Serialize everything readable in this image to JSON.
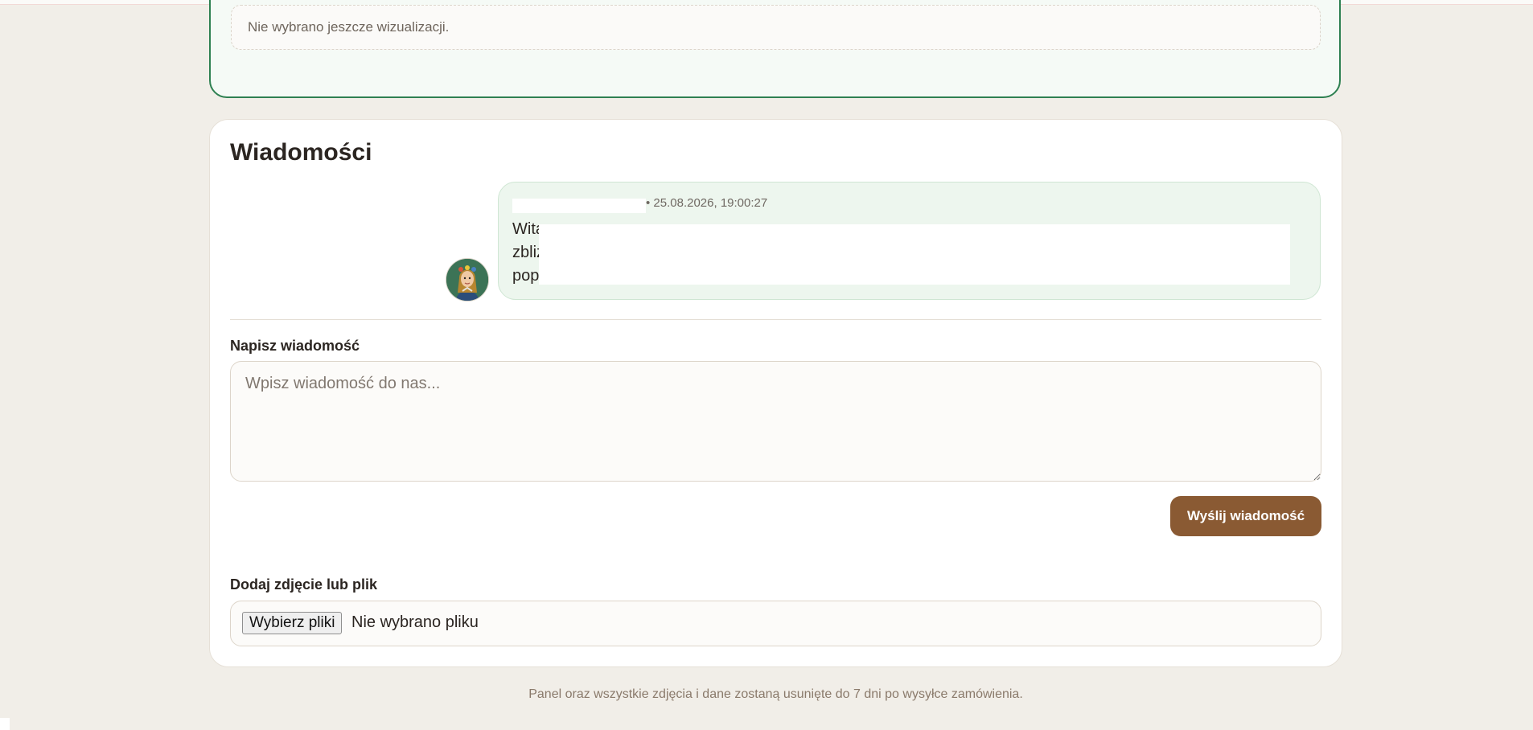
{
  "visualization": {
    "empty_text": "Nie wybrano jeszcze wizualizacji."
  },
  "messages": {
    "title": "Wiadomości",
    "items": [
      {
        "timestamp": "• 25.08.2026, 19:00:27",
        "lines": [
          "Wita",
          "zbliz",
          "pop"
        ]
      }
    ]
  },
  "composer": {
    "label": "Napisz wiadomość",
    "placeholder": "Wpisz wiadomość do nas...",
    "send_label": "Wyślij wiadomość"
  },
  "attachment": {
    "label": "Dodaj zdjęcie lub plik",
    "button_label": "Wybierz pliki",
    "status": "Nie wybrano pliku"
  },
  "footer": {
    "note": "Panel oraz wszystkie zdjęcia i dane zostaną usunięte do 7 dni po wysyłce zamówienia."
  },
  "colors": {
    "accent_green": "#2e8051",
    "bubble_green": "#edf6ee",
    "send_brown": "#8a5a33",
    "page_background": "#f1eee8"
  },
  "icons": {
    "avatar": "portrait-avatar"
  }
}
